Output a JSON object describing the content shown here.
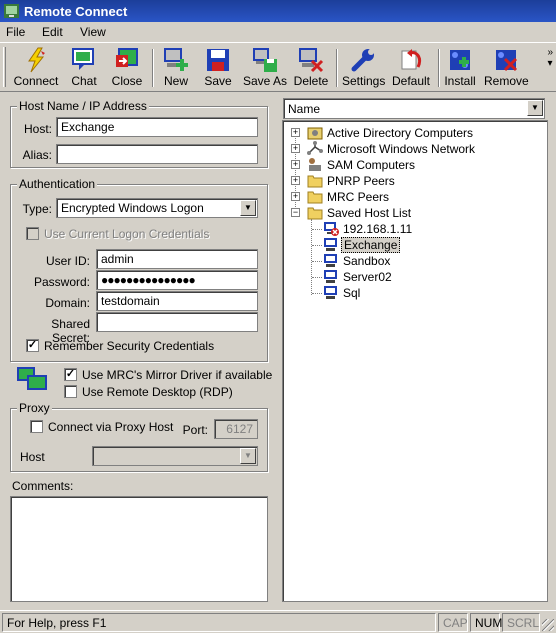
{
  "window": {
    "title": "Remote Connect"
  },
  "menu": [
    "File",
    "Edit",
    "View"
  ],
  "toolbar": {
    "buttons": [
      "Connect",
      "Chat",
      "Close",
      "New",
      "Save",
      "Save As",
      "Delete",
      "Settings",
      "Default",
      "Install",
      "Remove"
    ]
  },
  "host_group": {
    "label": "Host Name / IP Address",
    "host_label": "Host:",
    "host_value": "Exchange",
    "alias_label": "Alias:",
    "alias_value": ""
  },
  "auth_group": {
    "label": "Authentication",
    "type_label": "Type:",
    "type_value": "Encrypted Windows Logon",
    "use_current_label": "Use Current Logon Credentials",
    "userid_label": "User ID:",
    "userid_value": "admin",
    "password_label": "Password:",
    "password_value": "●●●●●●●●●●●●●●●",
    "domain_label": "Domain:",
    "domain_value": "testdomain",
    "shared_secret_label": "Shared Secret:",
    "shared_secret_value": "",
    "remember_label": "Remember Security Credentials"
  },
  "options": {
    "mirror_label": "Use MRC's Mirror Driver if available",
    "rdp_label": "Use Remote Desktop (RDP)"
  },
  "proxy_group": {
    "label": "Proxy",
    "connect_label": "Connect via Proxy Host",
    "port_label": "Port:",
    "port_value": "6127",
    "host_label": "Host",
    "host_value": ""
  },
  "comments": {
    "label": "Comments:",
    "value": ""
  },
  "tree": {
    "column": "Name",
    "items": [
      "Active Directory Computers",
      "Microsoft Windows Network",
      "SAM Computers",
      "PNRP Peers",
      "MRC Peers",
      "Saved Host List"
    ],
    "saved_hosts": [
      "192.168.1.11",
      "Exchange",
      "Sandbox",
      "Server02",
      "Sql"
    ]
  },
  "statusbar": {
    "text": "For Help, press F1",
    "cap": "CAP",
    "num": "NUM",
    "scrl": "SCRL"
  },
  "icons": {
    "connect": "lightning-icon",
    "chat": "chat-icon",
    "close": "close-icon",
    "new": "new-host-icon",
    "save": "floppy-icon",
    "save_as": "save-as-icon",
    "delete": "delete-host-icon",
    "settings": "wrench-icon",
    "default": "undo-icon",
    "install": "install-icon",
    "remove": "remove-icon"
  },
  "colors": {
    "title_bar": "#2a55c6",
    "window_bg": "#d4d0c8",
    "icon_blue": "#1f3fb5",
    "icon_red": "#d02020"
  }
}
